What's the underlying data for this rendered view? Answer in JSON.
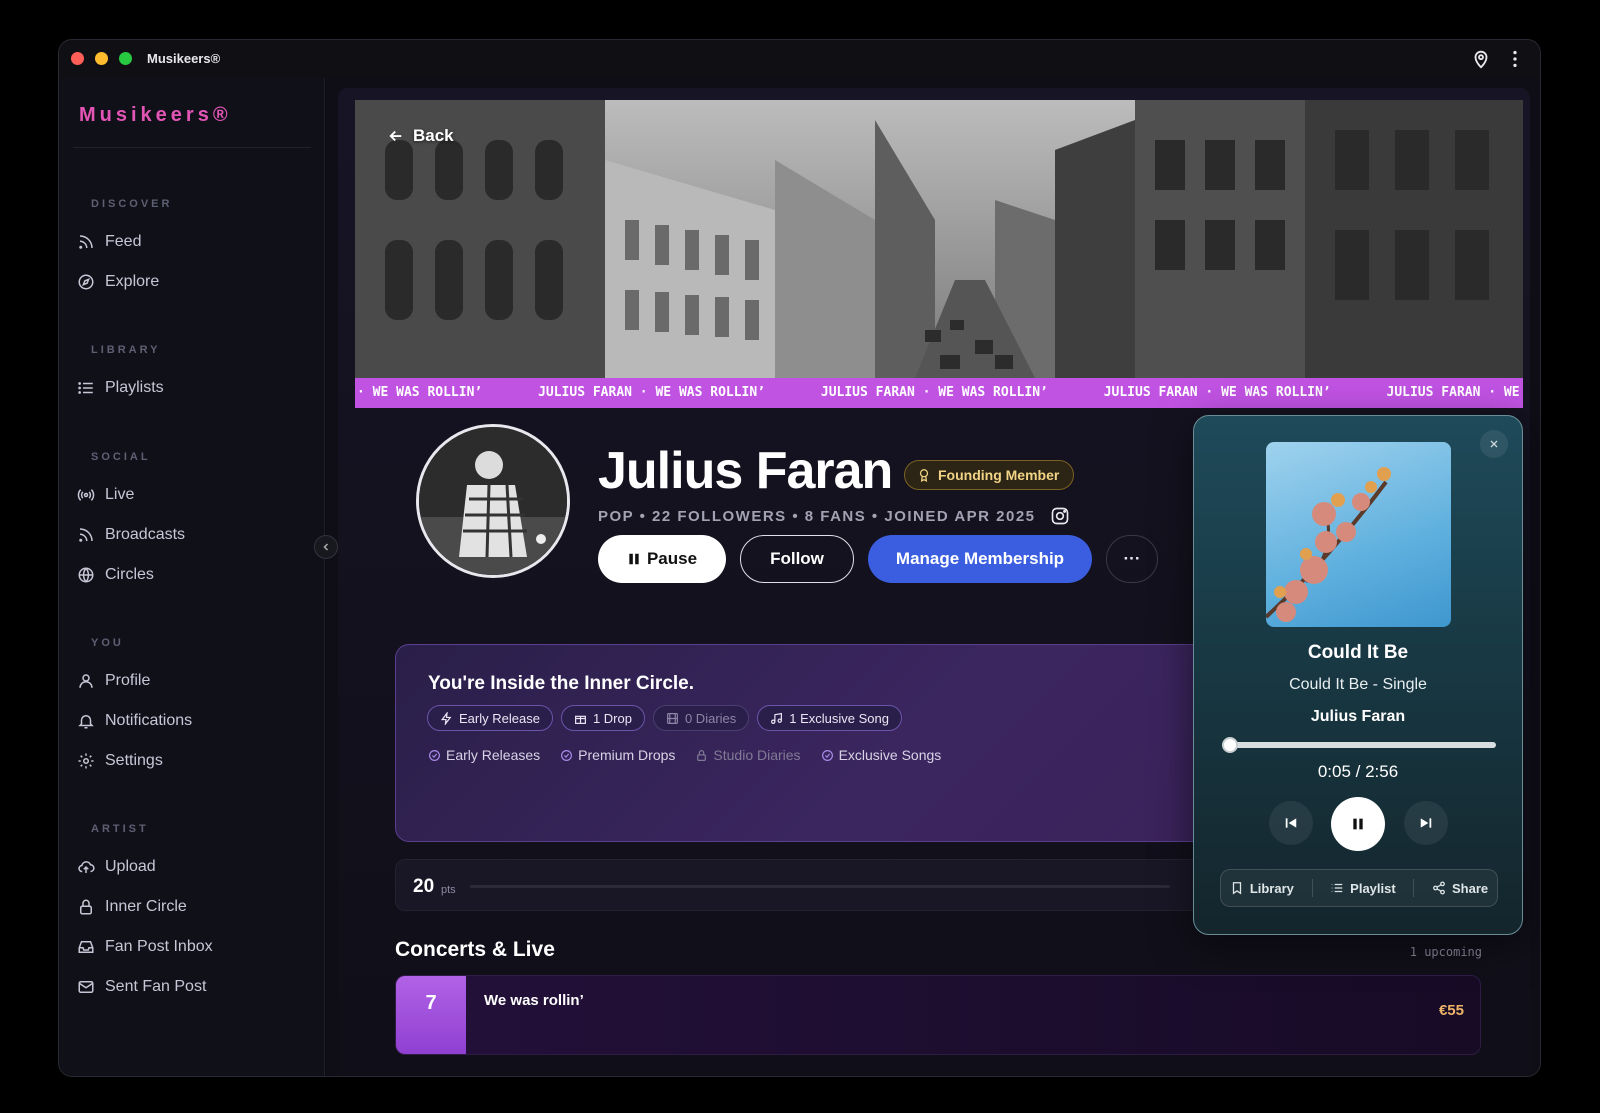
{
  "window": {
    "title": "Musikeers®"
  },
  "sidebar": {
    "logo": "Musikeers®",
    "sections": {
      "discover": "DISCOVER",
      "library": "LIBRARY",
      "social": "SOCIAL",
      "you": "YOU",
      "artist": "ARTIST"
    },
    "items": {
      "feed": "Feed",
      "explore": "Explore",
      "playlists": "Playlists",
      "live": "Live",
      "broadcasts": "Broadcasts",
      "circles": "Circles",
      "profile": "Profile",
      "notifications": "Notifications",
      "settings": "Settings",
      "upload": "Upload",
      "inner_circle": "Inner Circle",
      "fan_post_inbox": "Fan Post Inbox",
      "sent_fan_post": "Sent Fan Post"
    }
  },
  "hero": {
    "back_label": "Back",
    "ticker": [
      "· WE WAS ROLLIN’",
      "JULIUS FARAN · WE WAS ROLLIN’",
      "JULIUS FARAN · WE WAS ROLLIN’",
      "JULIUS FARAN · WE WAS ROLLIN’",
      "JULIUS FARAN · WE"
    ]
  },
  "artist": {
    "name": "Julius Faran",
    "badge": "Founding Member",
    "meta": "POP • 22 FOLLOWERS • 8 FANS • JOINED APR 2025",
    "pause_label": "Pause",
    "follow_label": "Follow",
    "membership_label": "Manage Membership",
    "more_label": "···"
  },
  "inner_circle": {
    "title": "You're Inside the Inner Circle.",
    "chips": {
      "early_release": "Early Release",
      "drop": "1 Drop",
      "diaries": "0 Diaries",
      "exclusive_song": "1 Exclusive Song"
    },
    "perks": {
      "early_releases": "Early Releases",
      "premium_drops": "Premium Drops",
      "studio_diaries": "Studio Diaries",
      "exclusive_songs": "Exclusive Songs"
    }
  },
  "points": {
    "value": "20",
    "unit": "pts"
  },
  "concerts": {
    "title": "Concerts & Live",
    "upcoming": "1 upcoming",
    "items": [
      {
        "day": "7",
        "name": "We was rollin’",
        "price": "€55"
      }
    ]
  },
  "player": {
    "title": "Could It Be",
    "album": "Could It Be - Single",
    "artist": "Julius Faran",
    "time": "0:05 / 2:56",
    "progress_fraction": 0.028,
    "actions": {
      "library": "Library",
      "playlist": "Playlist",
      "share": "Share"
    }
  },
  "colors": {
    "logo": "#e255b5",
    "ticker": "#c153e3",
    "membership_button": "#3b5ee0",
    "founding_badge": "#f1d486",
    "price": "#eeb368"
  }
}
